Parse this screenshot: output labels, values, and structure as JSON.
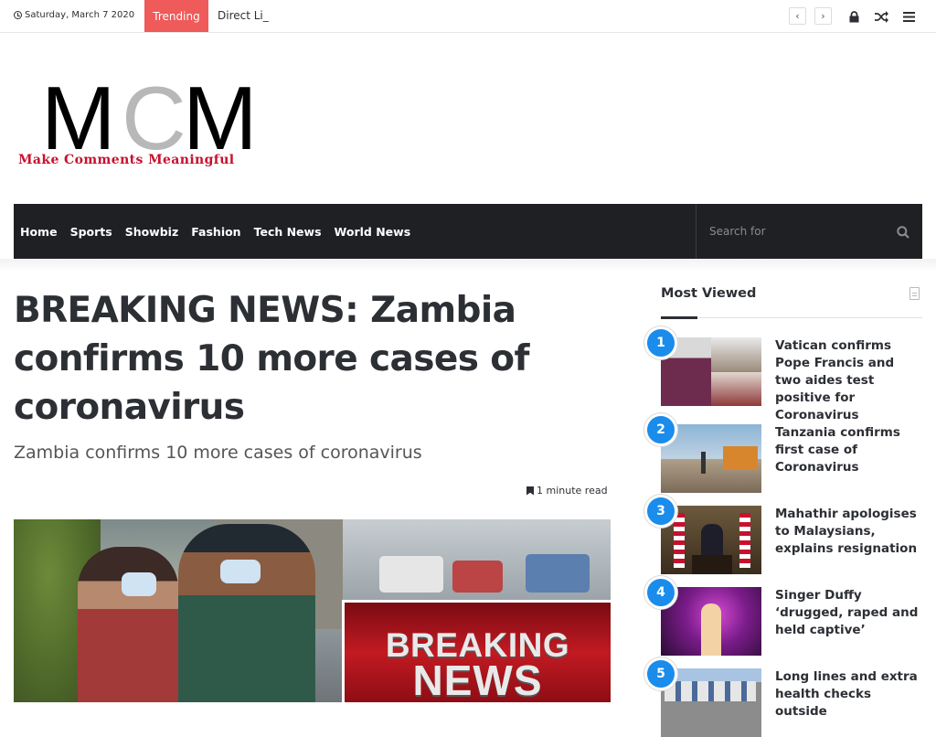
{
  "topbar": {
    "date": "Saturday, March 7 2020",
    "trending_label": "Trending",
    "ticker_text": "Direct Li_",
    "icons": [
      "chevron-left-icon",
      "chevron-right-icon",
      "lock-icon",
      "random-icon",
      "menu-icon"
    ]
  },
  "logo": {
    "letters": [
      "M",
      "C",
      "M"
    ],
    "tagline": "Make Comments Meaningful"
  },
  "nav": {
    "items": [
      "Home",
      "Sports",
      "Showbiz",
      "Fashion",
      "Tech News",
      "World News"
    ],
    "search_placeholder": "Search for"
  },
  "article": {
    "title": "BREAKING NEWS: Zambia confirms 10 more cases of coronavirus",
    "subtitle": "Zambia confirms 10 more cases of coronavirus",
    "read_time": "1 minute read",
    "hero_overlay_line1": "BREAKING",
    "hero_overlay_line2": "NEWS"
  },
  "sidebar": {
    "title": "Most Viewed",
    "items": [
      {
        "rank": "1",
        "title": "Vatican confirms Pope Francis and two aides test positive for Coronavirus"
      },
      {
        "rank": "2",
        "title": "Tanzania confirms first case of Coronavirus"
      },
      {
        "rank": "3",
        "title": "Mahathir apologises to Malaysians, explains resignation"
      },
      {
        "rank": "4",
        "title": "Singer Duffy ‘drugged, raped and held captive’"
      },
      {
        "rank": "5",
        "title": "Long lines and extra health checks outside"
      }
    ]
  },
  "colors": {
    "accent_red": "#ef5a5a",
    "nav_bg": "#1f2024",
    "rank_badge": "#1a8ceb",
    "logo_red": "#c8102e"
  }
}
